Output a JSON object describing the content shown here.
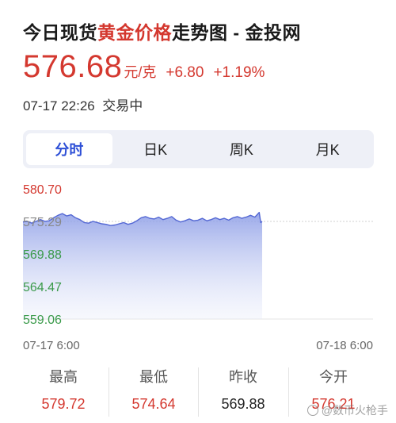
{
  "header": {
    "title_pre": "今日现货",
    "title_hl": "黄金价格",
    "title_post": "走势图 - 金投网"
  },
  "quote": {
    "price": "576.68",
    "unit": "元/克",
    "change": "+6.80",
    "change_pct": "+1.19%"
  },
  "status": {
    "time": "07-17 22:26",
    "state": "交易中"
  },
  "tabs": [
    {
      "label": "分时",
      "active": true
    },
    {
      "label": "日K",
      "active": false
    },
    {
      "label": "周K",
      "active": false
    },
    {
      "label": "月K",
      "active": false
    }
  ],
  "chart_data": {
    "type": "area",
    "y_ticks": [
      "580.70",
      "575.29",
      "569.88",
      "564.47",
      "559.06"
    ],
    "y_tick_values": [
      580.7,
      575.29,
      569.88,
      564.47,
      559.06
    ],
    "ylim": [
      559.06,
      580.7
    ],
    "reference_value": 575.29,
    "x_start_label": "07-17 6:00",
    "x_end_label": "07-18 6:00",
    "x_range_hours": [
      0,
      24
    ],
    "series": [
      {
        "x": [
          0,
          0.3,
          0.6,
          0.9,
          1.2,
          1.5,
          1.8,
          2.1,
          2.4,
          2.7,
          3.0,
          3.3,
          3.6,
          3.9,
          4.2,
          4.5,
          4.8,
          5.1,
          5.4,
          5.7,
          6.0,
          6.3,
          6.6,
          6.9,
          7.2,
          7.5,
          7.8,
          8.1,
          8.4,
          8.7,
          9.0,
          9.3,
          9.6,
          9.9,
          10.2,
          10.5,
          10.8,
          11.1,
          11.4,
          11.7,
          12.0,
          12.3,
          12.6,
          12.9,
          13.2,
          13.5,
          13.8,
          14.1,
          14.4,
          14.7,
          15.0,
          15.3,
          15.6,
          15.9,
          16.2,
          16.3,
          16.4
        ],
        "values": [
          575.2,
          575.3,
          575.0,
          575.3,
          575.6,
          575.3,
          575.4,
          575.9,
          576.3,
          576.6,
          576.2,
          576.4,
          575.9,
          575.6,
          575.1,
          575.0,
          575.3,
          575.1,
          574.9,
          574.8,
          574.6,
          574.7,
          574.9,
          575.1,
          574.8,
          575.0,
          575.4,
          575.9,
          576.1,
          575.8,
          575.7,
          576.0,
          575.6,
          575.8,
          576.1,
          575.5,
          575.2,
          575.4,
          575.7,
          575.4,
          575.5,
          575.8,
          575.4,
          575.6,
          575.9,
          575.6,
          575.8,
          575.5,
          575.9,
          576.1,
          575.8,
          576.0,
          576.3,
          576.0,
          576.8,
          575.1,
          575.3
        ]
      }
    ]
  },
  "stats": [
    {
      "label": "最高",
      "value": "579.72",
      "color": "red"
    },
    {
      "label": "最低",
      "value": "574.64",
      "color": "red"
    },
    {
      "label": "昨收",
      "value": "569.88",
      "color": "dark"
    },
    {
      "label": "今开",
      "value": "576.21",
      "color": "red"
    }
  ],
  "watermark": "@数币火枪手",
  "colors": {
    "accent_red": "#d4382f",
    "accent_green": "#3a9a4a",
    "line_blue": "#5468d4",
    "tab_active": "#2d4fd6"
  }
}
